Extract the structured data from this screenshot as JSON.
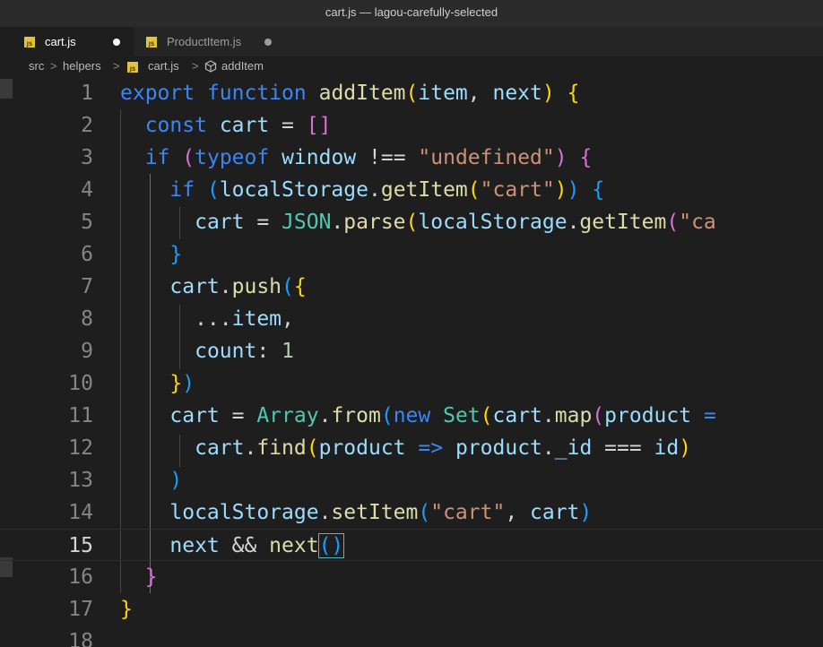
{
  "window": {
    "title": "cart.js — lagou-carefully-selected"
  },
  "tabs": [
    {
      "label": "cart.js",
      "icon": "js-file-icon",
      "active": true
    },
    {
      "label": "ProductItem.js",
      "icon": "js-file-icon",
      "active": false
    }
  ],
  "breadcrumb": {
    "items": [
      "src",
      "helpers",
      "cart.js",
      "addItem"
    ],
    "separator": ">"
  },
  "file_icon_text": "JS",
  "editor": {
    "current_line": 15,
    "line_numbers": [
      "1",
      "2",
      "3",
      "4",
      "5",
      "6",
      "7",
      "8",
      "9",
      "10",
      "11",
      "12",
      "13",
      "14",
      "15",
      "16",
      "17",
      "18"
    ],
    "lines": [
      "export function addItem(item, next) {",
      "  const cart = []",
      "  if (typeof window !== \"undefined\") {",
      "    if (localStorage.getItem(\"cart\")) {",
      "      cart = JSON.parse(localStorage.getItem(\"ca",
      "    }",
      "    cart.push({",
      "      ...item,",
      "      count: 1",
      "    })",
      "    cart = Array.from(new Set(cart.map(product =",
      "      cart.find(product => product._id === id)",
      "    )",
      "    localStorage.setItem(\"cart\", cart)",
      "    next && next()",
      "  }",
      "}",
      ""
    ]
  },
  "colors": {
    "keyword": "#3a86f7",
    "function": "#dcdcaa",
    "variable": "#9cdcfe",
    "string": "#ce9178",
    "number": "#b5cea8",
    "class": "#4ec9b0",
    "bracket_gold": "#ffd700",
    "bracket_purple": "#da70d6",
    "bracket_blue": "#179fff",
    "js_icon": "#e3c33a"
  }
}
